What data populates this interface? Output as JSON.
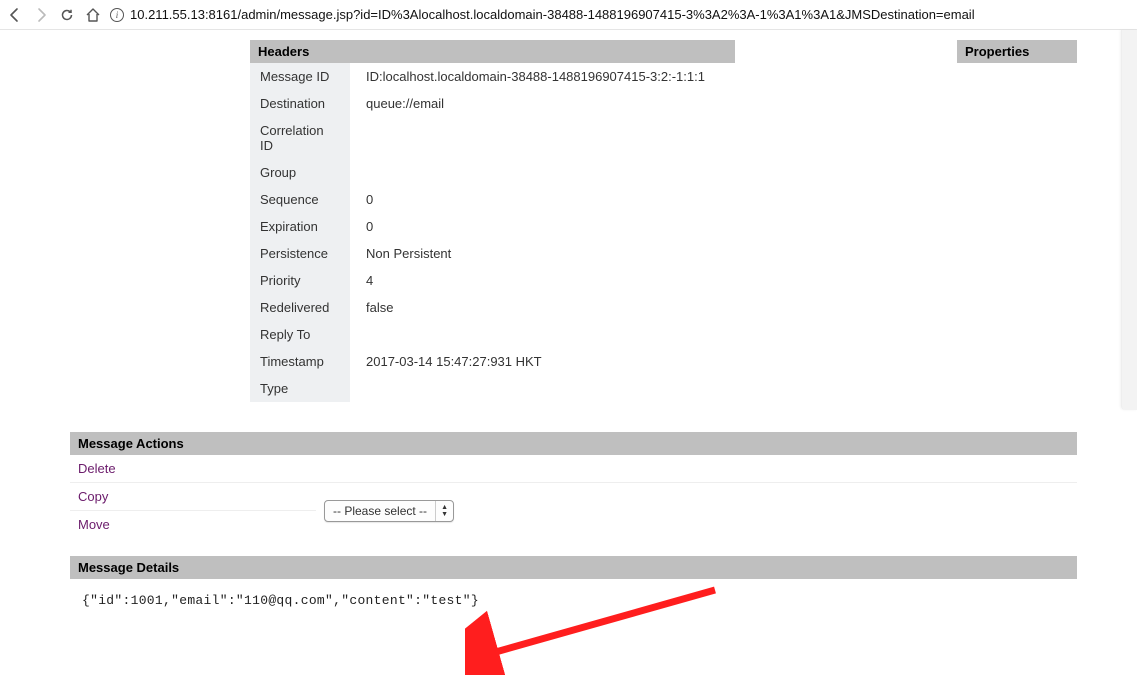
{
  "browser": {
    "url": "10.211.55.13:8161/admin/message.jsp?id=ID%3Alocalhost.localdomain-38488-1488196907415-3%3A2%3A-1%3A1%3A1&JMSDestination=email"
  },
  "headers_section": {
    "title": "Headers"
  },
  "properties_section": {
    "title": "Properties"
  },
  "headers": [
    {
      "label": "Message ID",
      "value": "ID:localhost.localdomain-38488-1488196907415-3:2:-1:1:1"
    },
    {
      "label": "Destination",
      "value": "queue://email"
    },
    {
      "label": "Correlation ID",
      "value": ""
    },
    {
      "label": "Group",
      "value": ""
    },
    {
      "label": "Sequence",
      "value": "0"
    },
    {
      "label": "Expiration",
      "value": "0"
    },
    {
      "label": "Persistence",
      "value": "Non Persistent"
    },
    {
      "label": "Priority",
      "value": "4"
    },
    {
      "label": "Redelivered",
      "value": "false"
    },
    {
      "label": "Reply To",
      "value": ""
    },
    {
      "label": "Timestamp",
      "value": "2017-03-14 15:47:27:931 HKT"
    },
    {
      "label": "Type",
      "value": ""
    }
  ],
  "actions_section": {
    "title": "Message Actions"
  },
  "actions": {
    "delete": "Delete",
    "copy": "Copy",
    "move": "Move",
    "select_placeholder": "-- Please select --"
  },
  "details_section": {
    "title": "Message Details"
  },
  "details_body": "{\"id\":1001,\"email\":\"110@qq.com\",\"content\":\"test\"}"
}
